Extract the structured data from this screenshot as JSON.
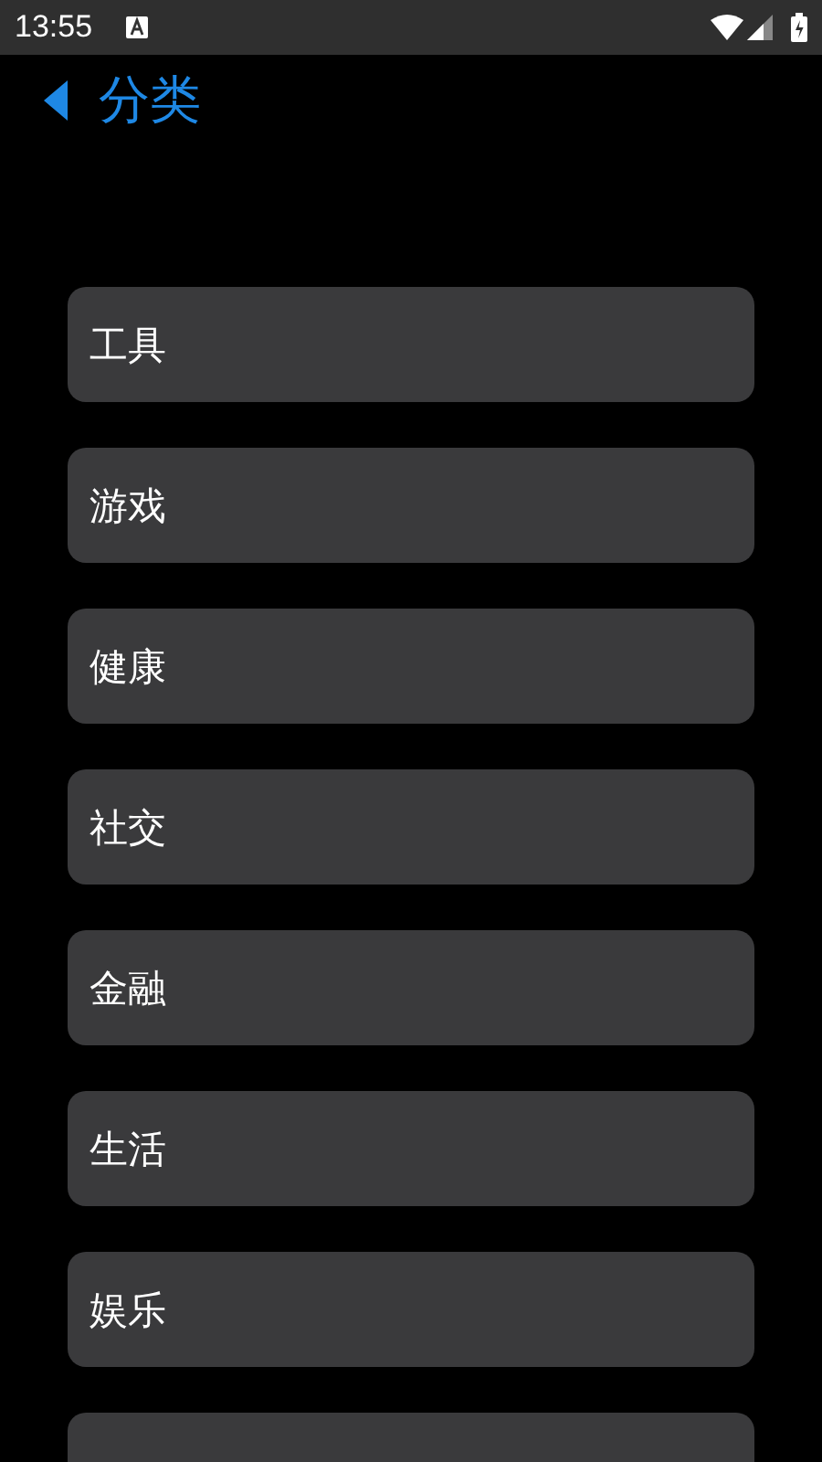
{
  "status_bar": {
    "time": "13:55"
  },
  "header": {
    "title": "分类"
  },
  "categories": [
    {
      "kind": "labeled",
      "label": "工具"
    },
    {
      "kind": "labeled",
      "label": "游戏"
    },
    {
      "kind": "labeled",
      "label": "健康"
    },
    {
      "kind": "labeled",
      "label": "社交"
    },
    {
      "kind": "labeled",
      "label": "金融"
    },
    {
      "kind": "labeled",
      "label": "生活"
    },
    {
      "kind": "labeled",
      "label": "娱乐"
    },
    {
      "kind": "cut-off"
    }
  ]
}
